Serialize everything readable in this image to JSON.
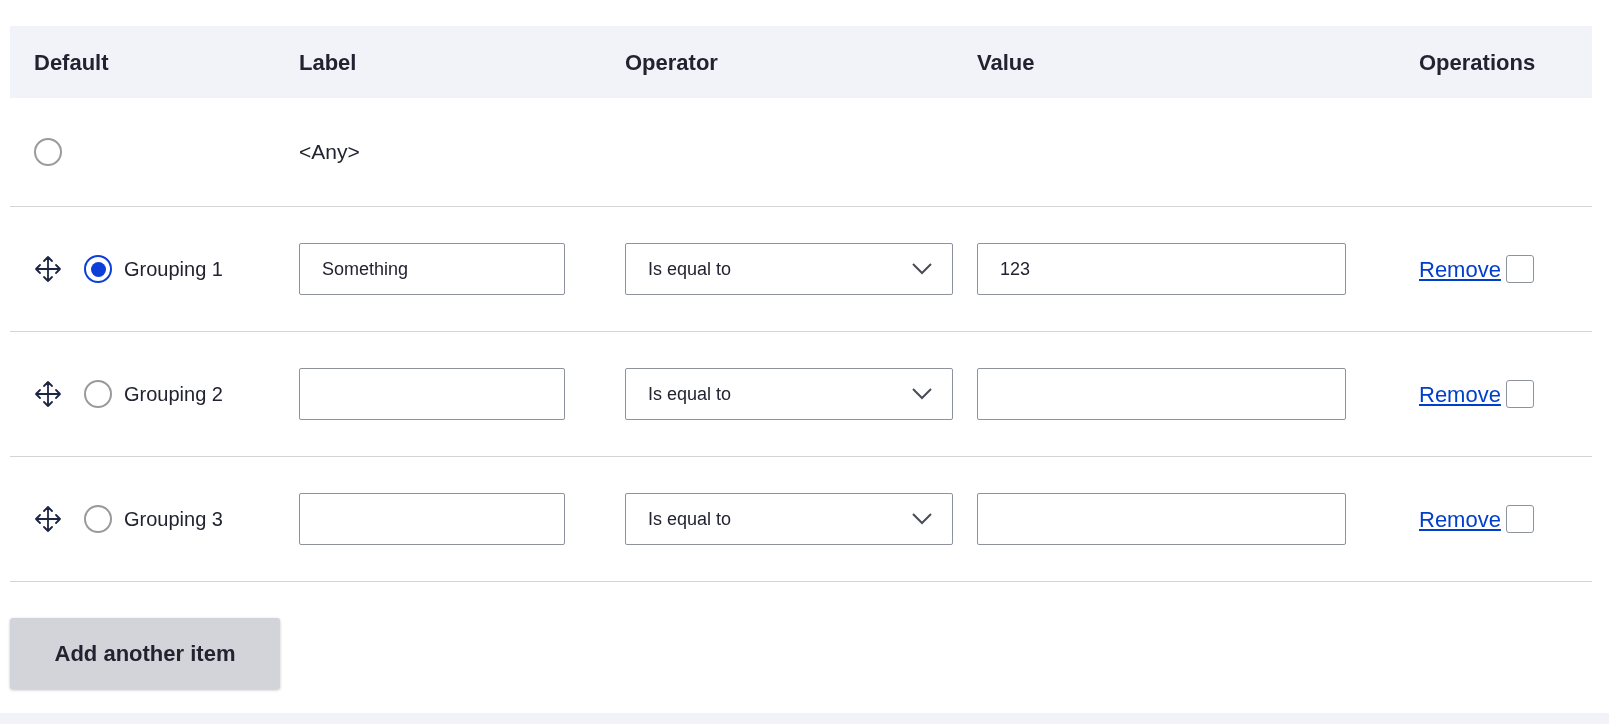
{
  "columns": [
    "Default",
    "Label",
    "Operator",
    "Value",
    "Operations"
  ],
  "any_row": {
    "selected": false,
    "label": "<Any>"
  },
  "rows": [
    {
      "selected": true,
      "name": "Grouping 1",
      "label_value": "Something",
      "operator": "Is equal to",
      "value": "123",
      "remove_link": "Remove",
      "remove_checked": false
    },
    {
      "selected": false,
      "name": "Grouping 2",
      "label_value": "",
      "operator": "Is equal to",
      "value": "",
      "remove_link": "Remove",
      "remove_checked": false
    },
    {
      "selected": false,
      "name": "Grouping 3",
      "label_value": "",
      "operator": "Is equal to",
      "value": "",
      "remove_link": "Remove",
      "remove_checked": false
    }
  ],
  "add_button": "Add another item"
}
